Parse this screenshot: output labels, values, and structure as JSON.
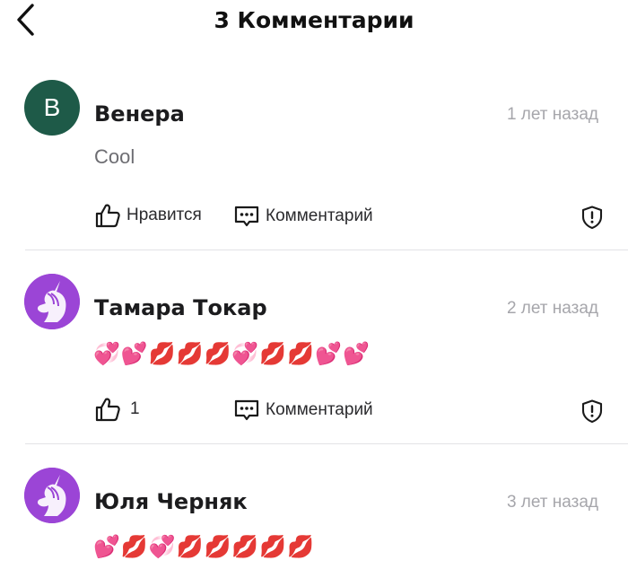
{
  "header": {
    "title": "3 Комментарии"
  },
  "actions": {
    "like_label": "Нравится",
    "comment_label": "Комментарий"
  },
  "comments": [
    {
      "author": "Венера",
      "avatar_letter": "B",
      "avatar_color": "#1e5a48",
      "time": "1 лет назад",
      "text": "Cool",
      "likes": ""
    },
    {
      "author": "Тамара Токар",
      "avatar_color": "#9b45d6",
      "time": "2 лет назад",
      "text": "💞💕💋💋💋💞💋💋💕💕",
      "likes": "1"
    },
    {
      "author": "Юля Черняк",
      "avatar_color": "#9b45d6",
      "time": "3 лет назад",
      "text": "💕💋💞💋💋💋💋💋"
    }
  ],
  "icons": {
    "back": "chevron-left-icon",
    "like": "thumbs-up-icon",
    "comment": "comment-bubble-icon",
    "report": "shield-alert-icon",
    "avatar": "unicorn-icon"
  }
}
